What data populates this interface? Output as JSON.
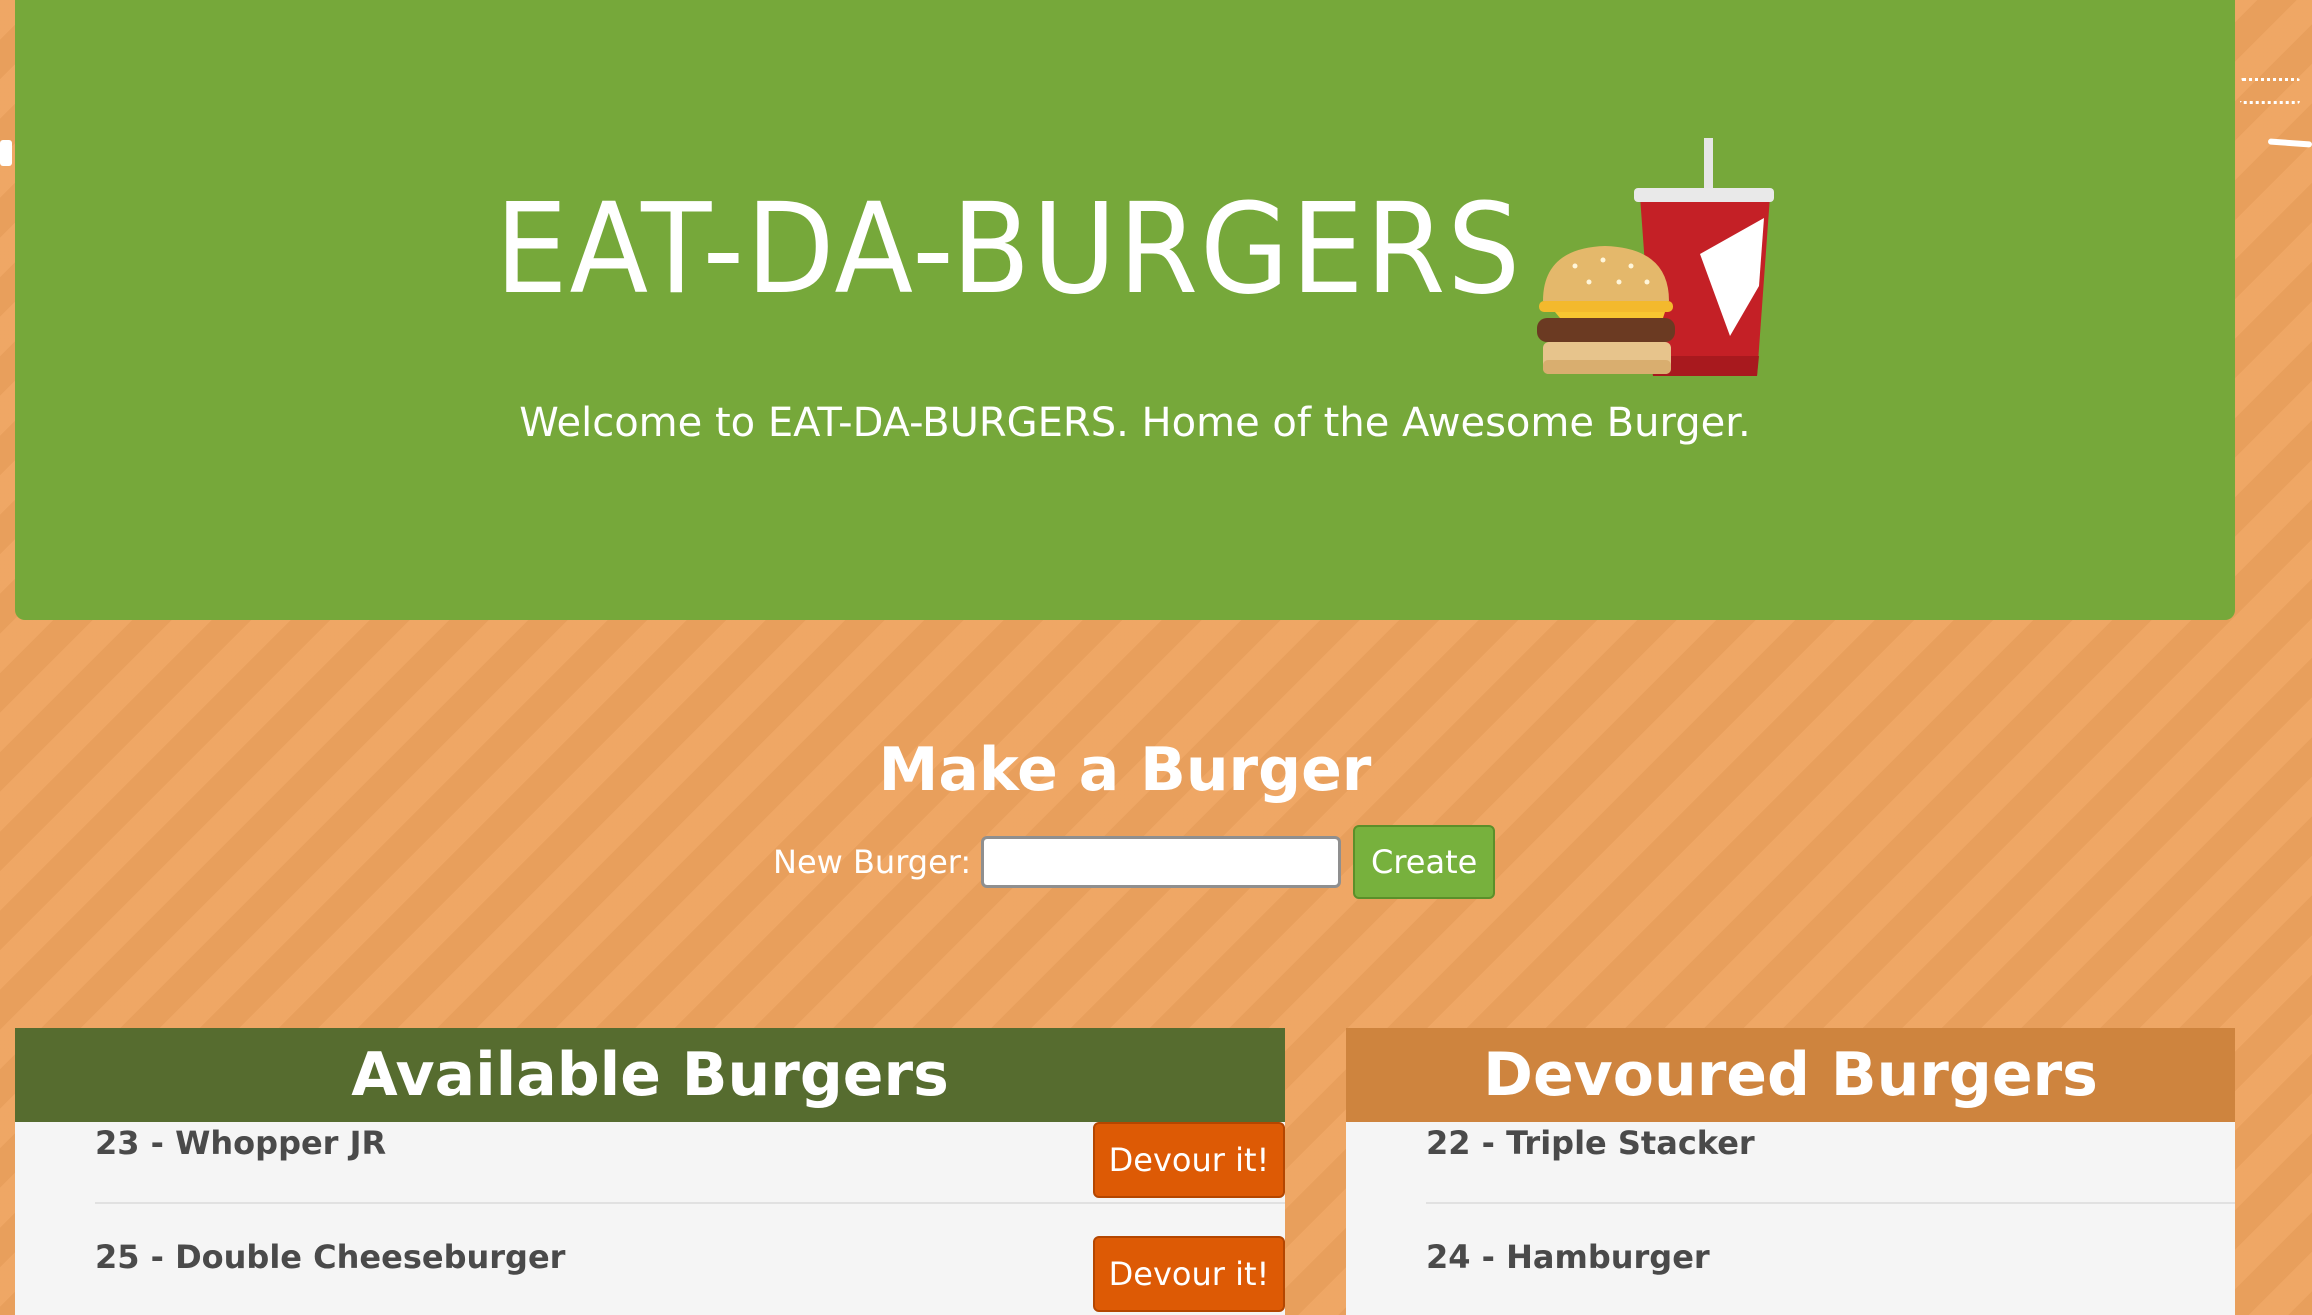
{
  "header": {
    "title": "EAT-DA-BURGERS",
    "subtitle": "Welcome to EAT-DA-BURGERS. Home of the Awesome Burger.",
    "logo_icon": "burger-and-drink-icon"
  },
  "form": {
    "heading": "Make a Burger",
    "label": "New Burger:",
    "input_value": "",
    "create_label": "Create"
  },
  "available": {
    "heading": "Available Burgers",
    "items": [
      {
        "label": "23 - Whopper JR",
        "button": "Devour it!"
      },
      {
        "label": "25 - Double Cheeseburger",
        "button": "Devour it!"
      }
    ]
  },
  "devoured": {
    "heading": "Devoured Burgers",
    "items": [
      {
        "label": "22 - Triple Stacker"
      },
      {
        "label": "24 - Hamburger"
      }
    ]
  },
  "colors": {
    "page_background": "#eea35e",
    "jumbotron": "#76a83a",
    "available_header": "#566c2f",
    "devoured_header": "#ce843e",
    "devour_button": "#dd5a05",
    "create_button": "#77b13d"
  }
}
